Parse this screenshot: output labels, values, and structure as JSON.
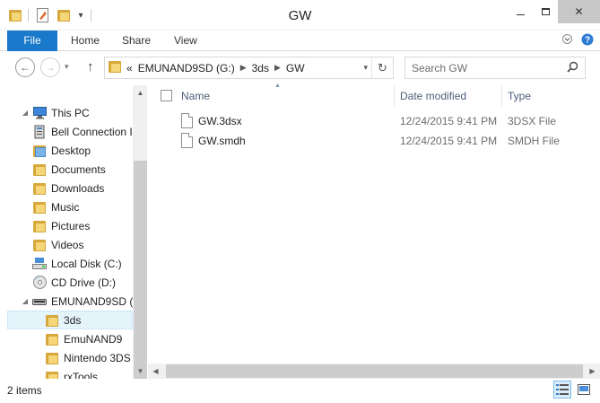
{
  "window": {
    "title": "GW"
  },
  "ribbon": {
    "tabs": [
      "File",
      "Home",
      "Share",
      "View"
    ]
  },
  "address": {
    "overflow": "«",
    "crumbs": [
      "EMUNAND9SD (G:)",
      "3ds",
      "GW"
    ]
  },
  "search": {
    "placeholder": "Search GW"
  },
  "nav": {
    "items": [
      {
        "label": "This PC",
        "icon": "computer-icon"
      },
      {
        "label": "Bell Connection I",
        "icon": "modem-icon"
      },
      {
        "label": "Desktop",
        "icon": "folder-icon"
      },
      {
        "label": "Documents",
        "icon": "folder-icon"
      },
      {
        "label": "Downloads",
        "icon": "folder-icon"
      },
      {
        "label": "Music",
        "icon": "folder-icon"
      },
      {
        "label": "Pictures",
        "icon": "folder-icon"
      },
      {
        "label": "Videos",
        "icon": "folder-icon"
      },
      {
        "label": "Local Disk (C:)",
        "icon": "drive-icon"
      },
      {
        "label": "CD Drive (D:)",
        "icon": "cd-icon"
      },
      {
        "label": "EMUNAND9SD (G",
        "icon": "removable-drive-icon"
      },
      {
        "label": "3ds",
        "icon": "folder-icon"
      },
      {
        "label": "EmuNAND9",
        "icon": "folder-icon"
      },
      {
        "label": "Nintendo 3DS",
        "icon": "folder-icon"
      },
      {
        "label": "rxTools",
        "icon": "folder-icon"
      }
    ]
  },
  "columns": {
    "name": "Name",
    "date": "Date modified",
    "type": "Type"
  },
  "files": [
    {
      "name": "GW.3dsx",
      "date": "12/24/2015 9:41 PM",
      "type": "3DSX File"
    },
    {
      "name": "GW.smdh",
      "date": "12/24/2015 9:41 PM",
      "type": "SMDH File"
    }
  ],
  "status": {
    "count": "2 items"
  },
  "colors": {
    "accent": "#1979ca",
    "folder": "#f5d678",
    "selection": "#e5f3fb"
  }
}
